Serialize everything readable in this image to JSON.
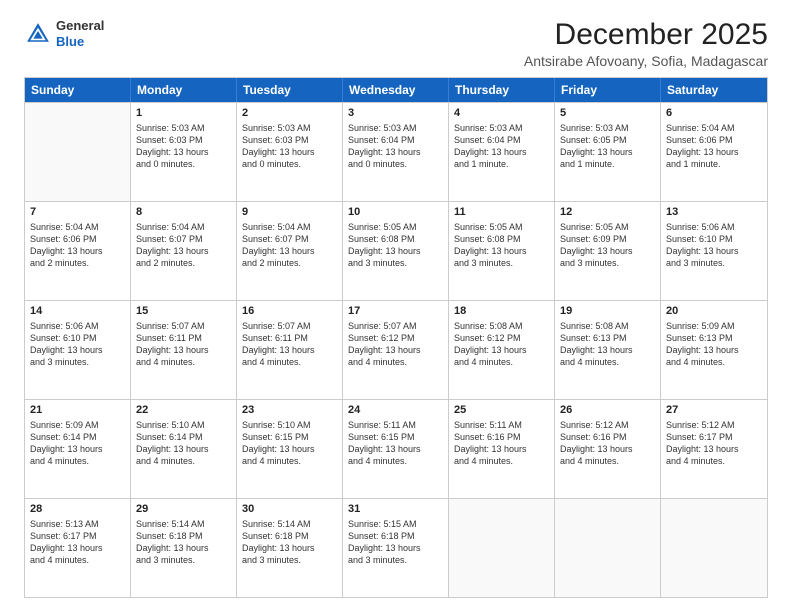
{
  "logo": {
    "line1": "General",
    "line2": "Blue"
  },
  "title": "December 2025",
  "subtitle": "Antsirabe Afovoany, Sofia, Madagascar",
  "days": [
    "Sunday",
    "Monday",
    "Tuesday",
    "Wednesday",
    "Thursday",
    "Friday",
    "Saturday"
  ],
  "rows": [
    [
      {
        "num": "",
        "lines": []
      },
      {
        "num": "1",
        "lines": [
          "Sunrise: 5:03 AM",
          "Sunset: 6:03 PM",
          "Daylight: 13 hours",
          "and 0 minutes."
        ]
      },
      {
        "num": "2",
        "lines": [
          "Sunrise: 5:03 AM",
          "Sunset: 6:03 PM",
          "Daylight: 13 hours",
          "and 0 minutes."
        ]
      },
      {
        "num": "3",
        "lines": [
          "Sunrise: 5:03 AM",
          "Sunset: 6:04 PM",
          "Daylight: 13 hours",
          "and 0 minutes."
        ]
      },
      {
        "num": "4",
        "lines": [
          "Sunrise: 5:03 AM",
          "Sunset: 6:04 PM",
          "Daylight: 13 hours",
          "and 1 minute."
        ]
      },
      {
        "num": "5",
        "lines": [
          "Sunrise: 5:03 AM",
          "Sunset: 6:05 PM",
          "Daylight: 13 hours",
          "and 1 minute."
        ]
      },
      {
        "num": "6",
        "lines": [
          "Sunrise: 5:04 AM",
          "Sunset: 6:06 PM",
          "Daylight: 13 hours",
          "and 1 minute."
        ]
      }
    ],
    [
      {
        "num": "7",
        "lines": [
          "Sunrise: 5:04 AM",
          "Sunset: 6:06 PM",
          "Daylight: 13 hours",
          "and 2 minutes."
        ]
      },
      {
        "num": "8",
        "lines": [
          "Sunrise: 5:04 AM",
          "Sunset: 6:07 PM",
          "Daylight: 13 hours",
          "and 2 minutes."
        ]
      },
      {
        "num": "9",
        "lines": [
          "Sunrise: 5:04 AM",
          "Sunset: 6:07 PM",
          "Daylight: 13 hours",
          "and 2 minutes."
        ]
      },
      {
        "num": "10",
        "lines": [
          "Sunrise: 5:05 AM",
          "Sunset: 6:08 PM",
          "Daylight: 13 hours",
          "and 3 minutes."
        ]
      },
      {
        "num": "11",
        "lines": [
          "Sunrise: 5:05 AM",
          "Sunset: 6:08 PM",
          "Daylight: 13 hours",
          "and 3 minutes."
        ]
      },
      {
        "num": "12",
        "lines": [
          "Sunrise: 5:05 AM",
          "Sunset: 6:09 PM",
          "Daylight: 13 hours",
          "and 3 minutes."
        ]
      },
      {
        "num": "13",
        "lines": [
          "Sunrise: 5:06 AM",
          "Sunset: 6:10 PM",
          "Daylight: 13 hours",
          "and 3 minutes."
        ]
      }
    ],
    [
      {
        "num": "14",
        "lines": [
          "Sunrise: 5:06 AM",
          "Sunset: 6:10 PM",
          "Daylight: 13 hours",
          "and 3 minutes."
        ]
      },
      {
        "num": "15",
        "lines": [
          "Sunrise: 5:07 AM",
          "Sunset: 6:11 PM",
          "Daylight: 13 hours",
          "and 4 minutes."
        ]
      },
      {
        "num": "16",
        "lines": [
          "Sunrise: 5:07 AM",
          "Sunset: 6:11 PM",
          "Daylight: 13 hours",
          "and 4 minutes."
        ]
      },
      {
        "num": "17",
        "lines": [
          "Sunrise: 5:07 AM",
          "Sunset: 6:12 PM",
          "Daylight: 13 hours",
          "and 4 minutes."
        ]
      },
      {
        "num": "18",
        "lines": [
          "Sunrise: 5:08 AM",
          "Sunset: 6:12 PM",
          "Daylight: 13 hours",
          "and 4 minutes."
        ]
      },
      {
        "num": "19",
        "lines": [
          "Sunrise: 5:08 AM",
          "Sunset: 6:13 PM",
          "Daylight: 13 hours",
          "and 4 minutes."
        ]
      },
      {
        "num": "20",
        "lines": [
          "Sunrise: 5:09 AM",
          "Sunset: 6:13 PM",
          "Daylight: 13 hours",
          "and 4 minutes."
        ]
      }
    ],
    [
      {
        "num": "21",
        "lines": [
          "Sunrise: 5:09 AM",
          "Sunset: 6:14 PM",
          "Daylight: 13 hours",
          "and 4 minutes."
        ]
      },
      {
        "num": "22",
        "lines": [
          "Sunrise: 5:10 AM",
          "Sunset: 6:14 PM",
          "Daylight: 13 hours",
          "and 4 minutes."
        ]
      },
      {
        "num": "23",
        "lines": [
          "Sunrise: 5:10 AM",
          "Sunset: 6:15 PM",
          "Daylight: 13 hours",
          "and 4 minutes."
        ]
      },
      {
        "num": "24",
        "lines": [
          "Sunrise: 5:11 AM",
          "Sunset: 6:15 PM",
          "Daylight: 13 hours",
          "and 4 minutes."
        ]
      },
      {
        "num": "25",
        "lines": [
          "Sunrise: 5:11 AM",
          "Sunset: 6:16 PM",
          "Daylight: 13 hours",
          "and 4 minutes."
        ]
      },
      {
        "num": "26",
        "lines": [
          "Sunrise: 5:12 AM",
          "Sunset: 6:16 PM",
          "Daylight: 13 hours",
          "and 4 minutes."
        ]
      },
      {
        "num": "27",
        "lines": [
          "Sunrise: 5:12 AM",
          "Sunset: 6:17 PM",
          "Daylight: 13 hours",
          "and 4 minutes."
        ]
      }
    ],
    [
      {
        "num": "28",
        "lines": [
          "Sunrise: 5:13 AM",
          "Sunset: 6:17 PM",
          "Daylight: 13 hours",
          "and 4 minutes."
        ]
      },
      {
        "num": "29",
        "lines": [
          "Sunrise: 5:14 AM",
          "Sunset: 6:18 PM",
          "Daylight: 13 hours",
          "and 3 minutes."
        ]
      },
      {
        "num": "30",
        "lines": [
          "Sunrise: 5:14 AM",
          "Sunset: 6:18 PM",
          "Daylight: 13 hours",
          "and 3 minutes."
        ]
      },
      {
        "num": "31",
        "lines": [
          "Sunrise: 5:15 AM",
          "Sunset: 6:18 PM",
          "Daylight: 13 hours",
          "and 3 minutes."
        ]
      },
      {
        "num": "",
        "lines": []
      },
      {
        "num": "",
        "lines": []
      },
      {
        "num": "",
        "lines": []
      }
    ]
  ]
}
